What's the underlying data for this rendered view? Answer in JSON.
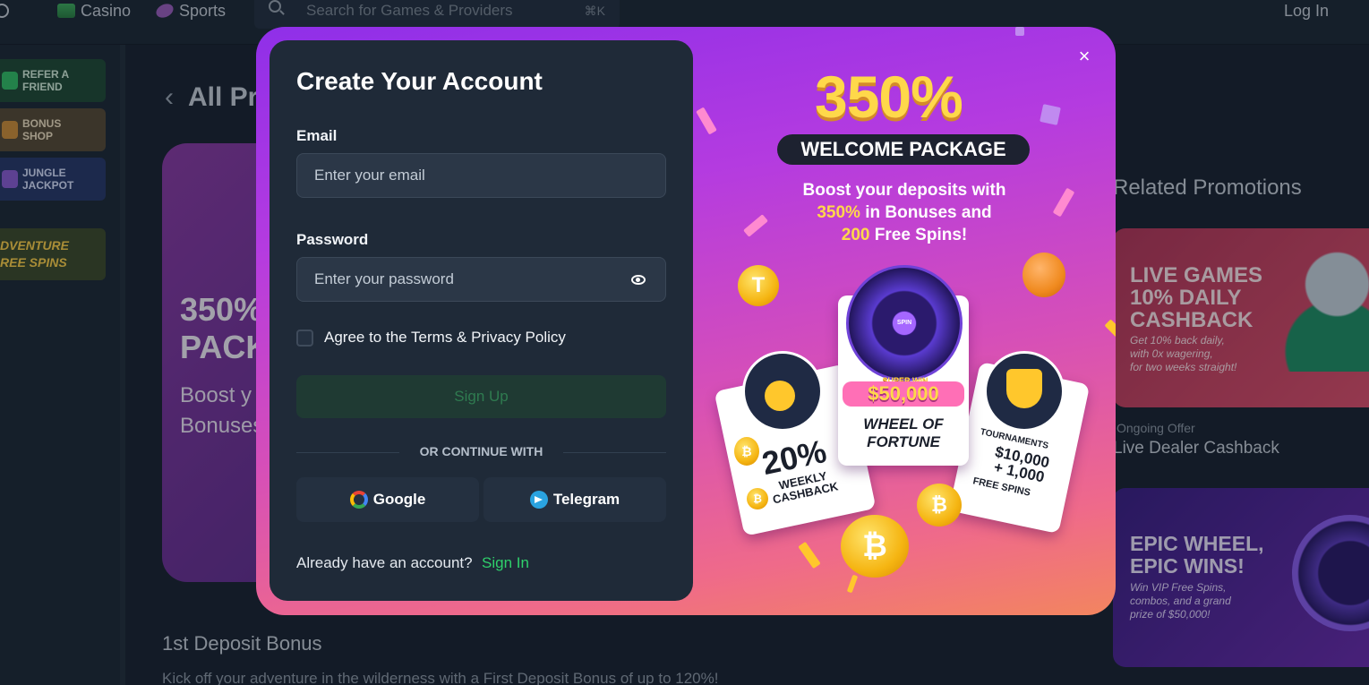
{
  "topbar": {
    "casino_label": "Casino",
    "sports_label": "Sports",
    "search_placeholder": "Search for Games & Providers",
    "search_shortcut": "⌘K",
    "login_label": "Log In"
  },
  "sidebar": {
    "items": [
      {
        "line1": "REFER A",
        "line2": "FRIEND"
      },
      {
        "line1": "BONUS",
        "line2": "SHOP"
      },
      {
        "line1": "JUNGLE",
        "line2": "JACKPOT"
      },
      {
        "line1": "DVENTURE",
        "line2": "REE SPINS"
      }
    ]
  },
  "background": {
    "back_title": "All Pr",
    "hero_line1": "350%",
    "hero_line2": "PACK",
    "hero_line3": "Boost y",
    "hero_line4": "Bonuses",
    "deposit_title": "1st Deposit Bonus",
    "deposit_text": "Kick off your adventure in the wilderness with a First Deposit Bonus of up to 120%!",
    "related_title": "Related Promotions",
    "related": [
      {
        "title_line1": "LIVE GAMES",
        "title_line2": "10% DAILY",
        "title_line3": "CASHBACK",
        "sub_line1": "Get 10% back daily,",
        "sub_line2": "with 0x wagering,",
        "sub_line3": "for two weeks straight!",
        "meta": "Ongoing Offer",
        "name": "Live Dealer Cashback"
      },
      {
        "title_line1": "EPIC WHEEL,",
        "title_line2": "EPIC WINS!",
        "sub_line1": "Win VIP Free Spins,",
        "sub_line2": "combos, and a grand",
        "sub_line3": "prize of $50,000!"
      }
    ]
  },
  "modal": {
    "title": "Create Your Account",
    "email_label": "Email",
    "email_placeholder": "Enter your email",
    "password_label": "Password",
    "password_placeholder": "Enter your password",
    "agree_label": "Agree to the Terms & Privacy Policy",
    "signup_label": "Sign Up",
    "divider_label": "OR CONTINUE WITH",
    "google_label": "Google",
    "telegram_label": "Telegram",
    "already_label": "Already have an account?",
    "signin_label": "Sign In",
    "close_glyph": "×"
  },
  "promo": {
    "percent": "350%",
    "pill": "WELCOME PACKAGE",
    "desc_line1": "Boost your deposits with",
    "desc_hl1": "350%",
    "desc_rest1": " in Bonuses and",
    "desc_hl2": "200",
    "desc_rest2": " Free Spins!",
    "weekly_big": "20%",
    "weekly_small1": "WEEKLY",
    "weekly_small2": "CASHBACK",
    "wheel_center": "SPIN",
    "superwin_label": "SUPER WIN",
    "superwin_amount": "$50,000",
    "wheel_line1": "WHEEL OF",
    "wheel_line2": "FORTUNE",
    "tournaments_label": "TOURNAMENTS",
    "tournaments_amount1": "$10,000",
    "tournaments_amount2": "+ 1,000",
    "tournaments_fs": "FREE SPINS"
  },
  "colors": {
    "accent_green": "#2fd06b",
    "promo_yellow": "#ffd84a",
    "modal_gradient_top": "#8f2fe8",
    "modal_gradient_bottom": "#f3855f"
  }
}
